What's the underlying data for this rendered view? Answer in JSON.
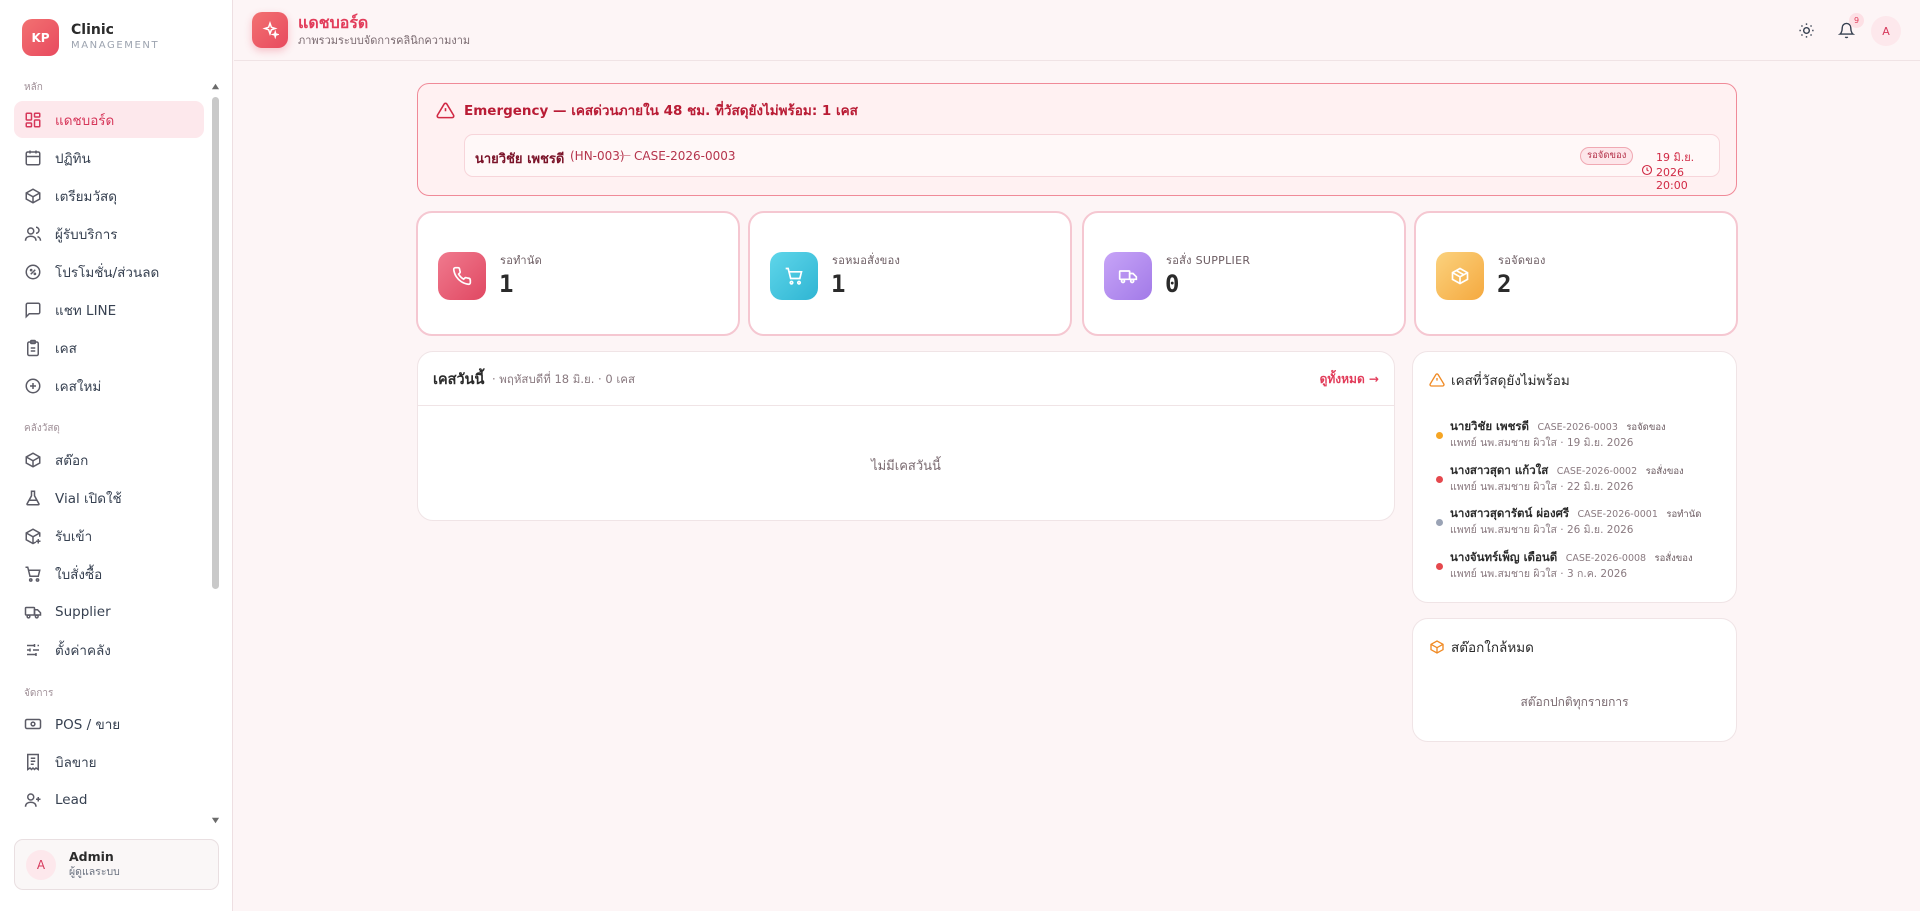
{
  "brand": {
    "logo": "KP",
    "name": "Clinic",
    "sub": "MANAGEMENT"
  },
  "sidebar": {
    "sections": [
      "หลัก",
      "คลังวัสดุ",
      "จัดการ"
    ],
    "items": [
      {
        "label": "แดชบอร์ด",
        "icon": "dashboard-icon",
        "active": true
      },
      {
        "label": "ปฏิทิน",
        "icon": "calendar-icon"
      },
      {
        "label": "เตรียมวัสดุ",
        "icon": "package-icon"
      },
      {
        "label": "ผู้รับบริการ",
        "icon": "users-icon"
      },
      {
        "label": "โปรโมชั่น/ส่วนลด",
        "icon": "discount-icon"
      },
      {
        "label": "แชท LINE",
        "icon": "chat-icon"
      },
      {
        "label": "เคส",
        "icon": "clipboard-icon"
      },
      {
        "label": "เคสใหม่",
        "icon": "plus-circle-icon"
      },
      {
        "label": "สต๊อก",
        "icon": "box-icon"
      },
      {
        "label": "Vial เปิดใช้",
        "icon": "flask-icon"
      },
      {
        "label": "รับเข้า",
        "icon": "box-plus-icon"
      },
      {
        "label": "ใบสั่งซื้อ",
        "icon": "cart-icon"
      },
      {
        "label": "Supplier",
        "icon": "truck-icon"
      },
      {
        "label": "ตั้งค่าคลัง",
        "icon": "sliders-icon"
      },
      {
        "label": "POS / ขาย",
        "icon": "cash-icon"
      },
      {
        "label": "บิลขาย",
        "icon": "receipt-icon"
      },
      {
        "label": "Lead",
        "icon": "user-plus-icon"
      }
    ]
  },
  "user": {
    "initial": "A",
    "name": "Admin",
    "role": "ผู้ดูแลระบบ"
  },
  "header": {
    "title": "แดชบอร์ด",
    "subtitle": "ภาพรวมระบบจัดการคลินิกความงาม",
    "notif_count": "9",
    "avatar": "A"
  },
  "emergency": {
    "title": "Emergency — เคสด่วนภายใน 48 ชม. ที่วัสดุยังไม่พร้อม: 1 เคส",
    "name": "นายวิชัย เพชรดี",
    "hn": "(HN-003)",
    "dash": "—",
    "case": "CASE-2026-0003",
    "badge": "รอจัดของ",
    "datetime": "19 มิ.ย. 2026 20:00",
    "colors": {
      "accent": "#d12a45",
      "bg": "#fff1f2"
    }
  },
  "stats": [
    {
      "label": "รอทำนัด",
      "value": "1",
      "icon": "phone-icon",
      "color": "#e8566f"
    },
    {
      "label": "รอหมอสั่งของ",
      "value": "1",
      "icon": "cart-icon",
      "color": "#3fc6dc"
    },
    {
      "label": "รอสั่ง SUPPLIER",
      "value": "0",
      "icon": "truck-icon",
      "color": "#b48ef0"
    },
    {
      "label": "รอจัดของ",
      "value": "2",
      "icon": "package-icon",
      "color": "#f7bd5c"
    }
  ],
  "today": {
    "title": "เคสวันนี้",
    "sub": "· พฤหัสบดีที่ 18 มิ.ย. · 0 เคส",
    "link": "ดูทั้งหมด →",
    "empty": "ไม่มีเคสวันนี้"
  },
  "notready": {
    "title": "เคสที่วัสดุยังไม่พร้อม",
    "items": [
      {
        "name": "นายวิชัย เพชรดี",
        "code": "CASE-2026-0003",
        "status": "รอจัดของ",
        "detail": "แพทย์ นพ.สมชาย ผิวใส · 19 มิ.ย. 2026",
        "dot": "#f5a524"
      },
      {
        "name": "นางสาวสุดา แก้วใส",
        "code": "CASE-2026-0002",
        "status": "รอสั่งของ",
        "detail": "แพทย์ นพ.สมชาย ผิวใส · 22 มิ.ย. 2026",
        "dot": "#e5484d"
      },
      {
        "name": "นางสาวสุดารัตน์ ผ่องศรี",
        "code": "CASE-2026-0001",
        "status": "รอทำนัด",
        "detail": "แพทย์ นพ.สมชาย ผิวใส · 26 มิ.ย. 2026",
        "dot": "#9aa3b5"
      },
      {
        "name": "นางจันทร์เพ็ญ เดือนดี",
        "code": "CASE-2026-0008",
        "status": "รอสั่งของ",
        "detail": "แพทย์ นพ.สมชาย ผิวใส · 3 ก.ค. 2026",
        "dot": "#e5484d"
      }
    ]
  },
  "stock": {
    "title": "สต๊อกใกล้หมด",
    "empty": "สต๊อกปกติทุกรายการ"
  }
}
